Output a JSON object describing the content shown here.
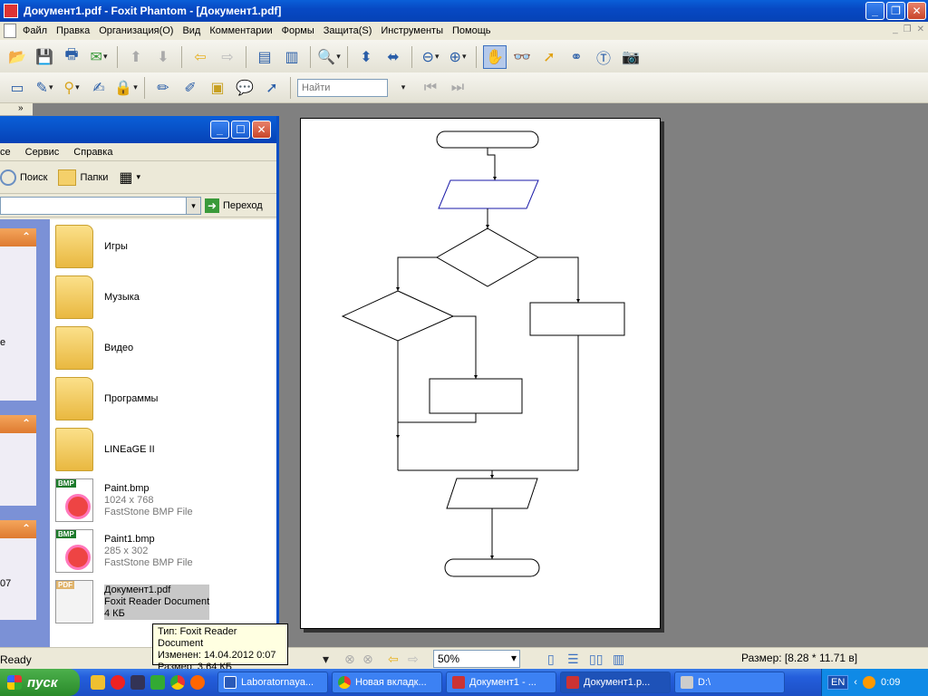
{
  "window": {
    "title": "Документ1.pdf - Foxit Phantom - [Документ1.pdf]"
  },
  "menu": [
    "Файл",
    "Правка",
    "Организация(O)",
    "Вид",
    "Комментарии",
    "Формы",
    "Защита(S)",
    "Инструменты",
    "Помощь"
  ],
  "toolbar": {
    "find_placeholder": "Найти"
  },
  "explorer": {
    "menu": [
      "се",
      "Сервис",
      "Справка"
    ],
    "search_label": "Поиск",
    "folders_label": "Папки",
    "go_label": "Переход",
    "files": [
      {
        "name": "Игры",
        "type": "folder"
      },
      {
        "name": "Музыка",
        "type": "folder"
      },
      {
        "name": "Видео",
        "type": "folder"
      },
      {
        "name": "Программы",
        "type": "folder"
      },
      {
        "name": "LINEaGE II",
        "type": "folder"
      },
      {
        "name": "Paint.bmp",
        "line2": "1024 x 768",
        "line3": "FastStone BMP File",
        "type": "bmp"
      },
      {
        "name": "Paint1.bmp",
        "line2": "285 x 302",
        "line3": "FastStone BMP File",
        "type": "bmp"
      },
      {
        "name": "Документ1.pdf",
        "line2": "Foxit Reader Document",
        "line3": "4 КБ",
        "type": "pdf"
      }
    ],
    "side_fragments": [
      "е",
      "07"
    ]
  },
  "tooltip": {
    "line1": "Тип: Foxit Reader Document",
    "line2": "Изменен: 14.04.2012 0:07",
    "line3": "Размер: 3,64 КБ"
  },
  "status": {
    "ready": "Ready",
    "zoom": "50%",
    "page_size": "Размер: [8.28 * 11.71 в]"
  },
  "taskbar": {
    "start": "пуск",
    "tasks": [
      "Laboratornaya...",
      "Новая вкладк...",
      "Документ1 - ...",
      "Документ1.p...",
      "D:\\"
    ],
    "lang": "EN",
    "clock": "0:09"
  }
}
